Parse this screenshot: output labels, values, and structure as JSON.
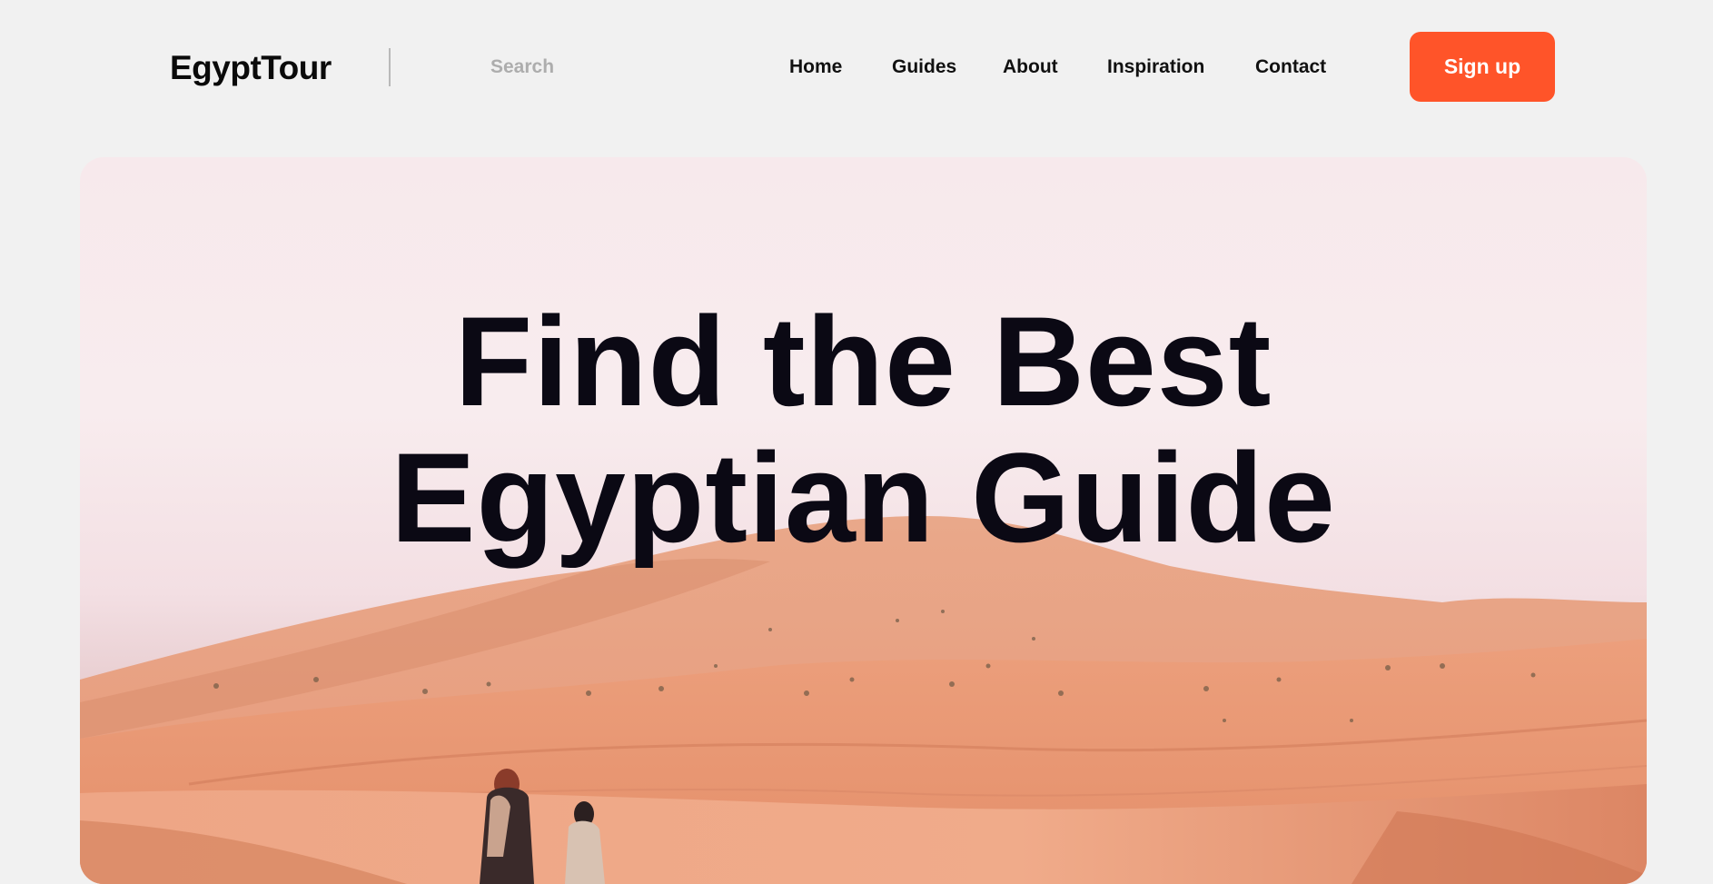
{
  "brand": {
    "name": "EgyptTour"
  },
  "search": {
    "placeholder": "Search"
  },
  "nav": {
    "items": [
      {
        "label": "Home"
      },
      {
        "label": "Guides"
      },
      {
        "label": "About"
      },
      {
        "label": "Inspiration"
      },
      {
        "label": "Contact"
      }
    ]
  },
  "cta": {
    "signup_label": "Sign up"
  },
  "hero": {
    "title_line1": "Find the Best",
    "title_line2": "Egyptian Guide"
  },
  "colors": {
    "accent": "#ff5429",
    "background": "#f1f1f1",
    "title": "#0b0914",
    "sand": "#e89a74"
  }
}
